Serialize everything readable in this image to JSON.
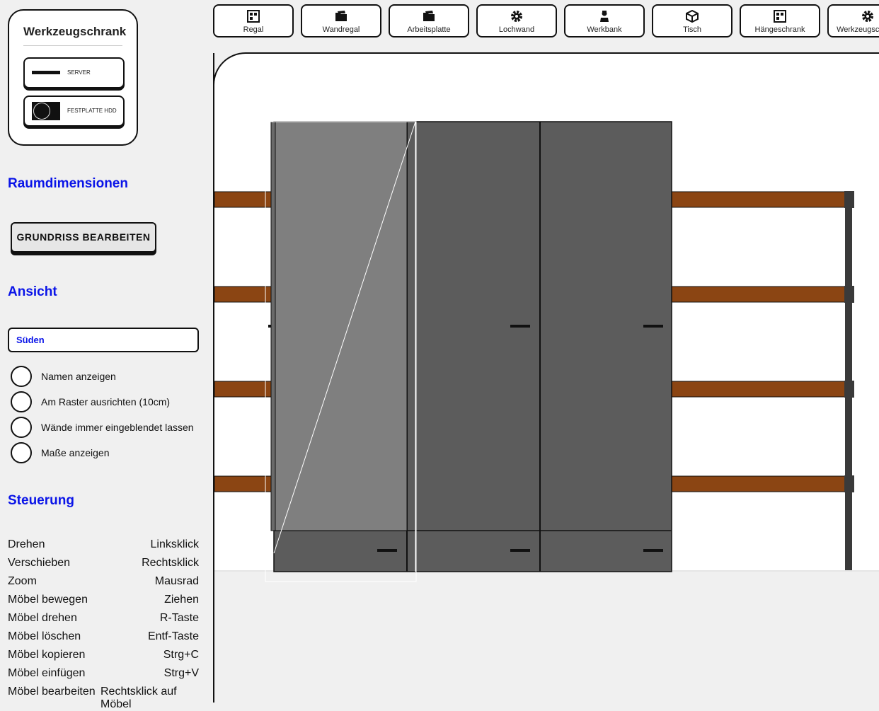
{
  "cabinet_card": {
    "title": "Werkzeugschrank",
    "items": [
      {
        "label": "SERVER",
        "icon": "server-icon"
      },
      {
        "label": "FESTPLATTE HDD",
        "icon": "hdd-icon"
      }
    ]
  },
  "sections": {
    "room": "Raumdimensionen",
    "view": "Ansicht",
    "controls": "Steuerung"
  },
  "room": {
    "edit_button": "GRUNDRISS BEARBEITEN"
  },
  "view": {
    "selected": "Süden",
    "options": [
      {
        "label": "Namen anzeigen",
        "checked": false
      },
      {
        "label": "Am Raster ausrichten (10cm)",
        "checked": false
      },
      {
        "label": "Wände immer eingeblendet lassen",
        "checked": false
      },
      {
        "label": "Maße anzeigen",
        "checked": false
      }
    ]
  },
  "controls": [
    {
      "action": "Drehen",
      "key": "Linksklick"
    },
    {
      "action": "Verschieben",
      "key": "Rechtsklick"
    },
    {
      "action": "Zoom",
      "key": "Mausrad"
    },
    {
      "action": "Möbel bewegen",
      "key": "Ziehen"
    },
    {
      "action": "Möbel drehen",
      "key": "R-Taste"
    },
    {
      "action": "Möbel löschen",
      "key": "Entf-Taste"
    },
    {
      "action": "Möbel kopieren",
      "key": "Strg+C"
    },
    {
      "action": "Möbel einfügen",
      "key": "Strg+V"
    },
    {
      "action": "Möbel bearbeiten",
      "key": "Rechtsklick auf Möbel"
    }
  ],
  "toolbar": [
    {
      "label": "Regal",
      "icon": "grid-icon"
    },
    {
      "label": "Wandregal",
      "icon": "folder-icon"
    },
    {
      "label": "Arbeitsplatte",
      "icon": "folder-icon"
    },
    {
      "label": "Lochwand",
      "icon": "gear-icon"
    },
    {
      "label": "Werkbank",
      "icon": "worker-icon"
    },
    {
      "label": "Tisch",
      "icon": "box-icon"
    },
    {
      "label": "Hängeschrank",
      "icon": "grid-icon"
    },
    {
      "label": "Werkzeugschrank",
      "icon": "gear-icon"
    }
  ],
  "colors": {
    "accent": "#0a14e8",
    "shelf_wood": "#8b4513",
    "cabinet_body": "#5c5c5c",
    "cabinet_door_open": "#7f7f7f"
  }
}
